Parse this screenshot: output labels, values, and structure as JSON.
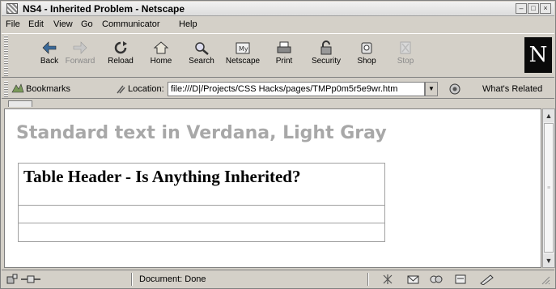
{
  "window": {
    "title": "NS4 - Inherited Problem - Netscape"
  },
  "menu": [
    "File",
    "Edit",
    "View",
    "Go",
    "Communicator",
    "Help"
  ],
  "toolbar": {
    "buttons": [
      {
        "label": "Back",
        "icon": "back-arrow-icon",
        "enabled": true
      },
      {
        "label": "Forward",
        "icon": "forward-arrow-icon",
        "enabled": false
      },
      {
        "label": "Reload",
        "icon": "reload-icon",
        "enabled": true
      },
      {
        "label": "Home",
        "icon": "home-icon",
        "enabled": true
      },
      {
        "label": "Search",
        "icon": "search-icon",
        "enabled": true
      },
      {
        "label": "Netscape",
        "icon": "netscape-icon",
        "enabled": true
      },
      {
        "label": "Print",
        "icon": "print-icon",
        "enabled": true
      },
      {
        "label": "Security",
        "icon": "padlock-icon",
        "enabled": true
      },
      {
        "label": "Shop",
        "icon": "shop-icon",
        "enabled": true
      },
      {
        "label": "Stop",
        "icon": "stop-icon",
        "enabled": false
      }
    ],
    "logo": "N"
  },
  "location": {
    "bookmarks_label": "Bookmarks",
    "location_label": "Location:",
    "url": "file:///D|/Projects/CSS Hacks/pages/TMPp0m5r5e9wr.htm",
    "related_label": "What's Related"
  },
  "page": {
    "heading": "Standard text in Verdana, Light Gray",
    "heading_color": "#a8a8a8",
    "table_header": "Table Header - Is Anything Inherited?"
  },
  "status": {
    "text": "Document: Done"
  }
}
